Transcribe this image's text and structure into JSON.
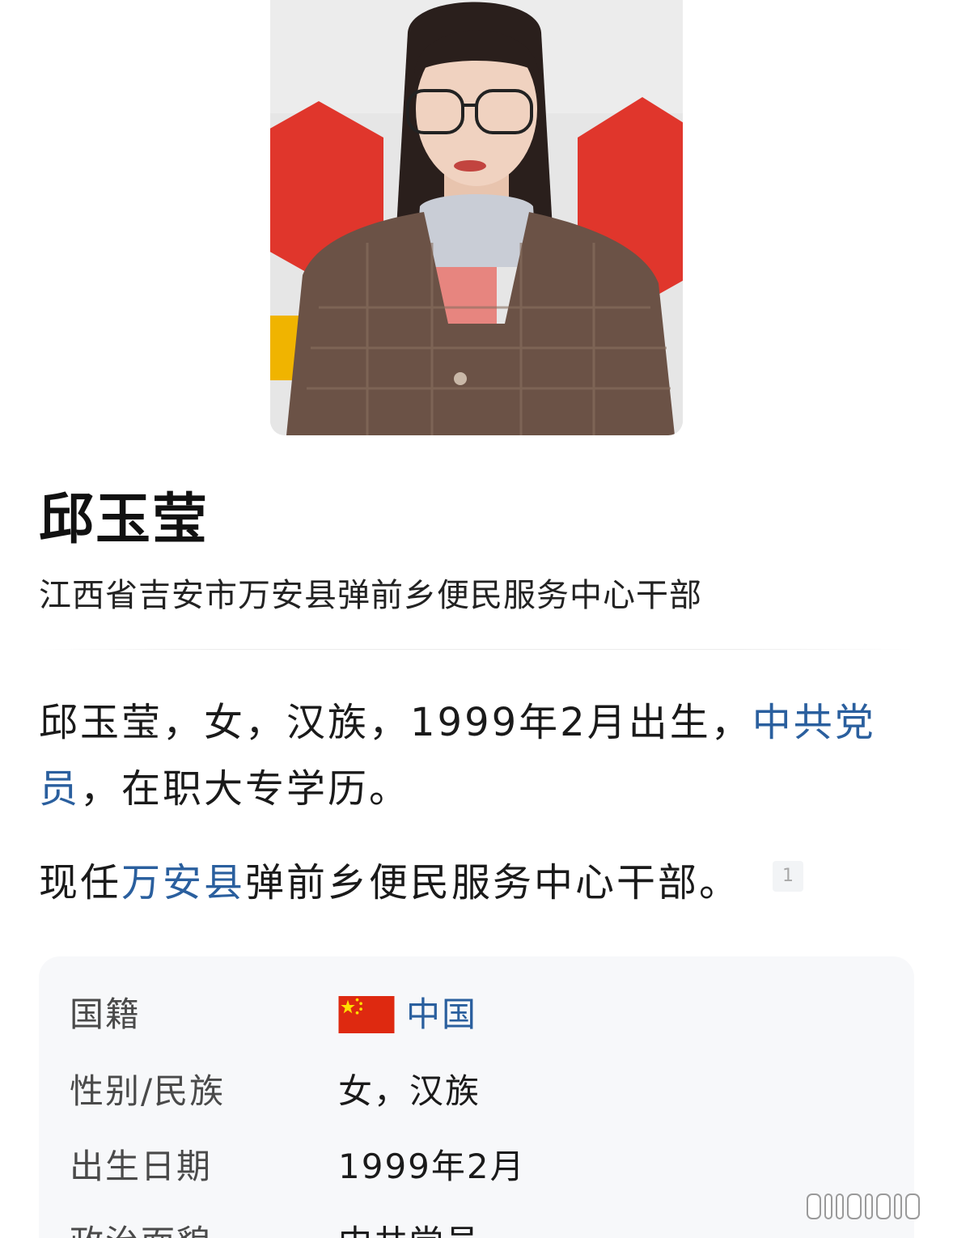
{
  "entry": {
    "title": "邱玉莹",
    "subtitle": "江西省吉安市万安县弹前乡便民服务中心干部"
  },
  "summary": {
    "p1_a": "邱玉莹，女，汉族，1999年2月出生，",
    "p1_link": "中共党员",
    "p1_b": "，在职大专学历。",
    "p2_a": "现任",
    "p2_link": "万安县",
    "p2_b": "弹前乡便民服务中心干部。",
    "p2_ref": "1"
  },
  "info": [
    {
      "label": "国籍",
      "value": "中国",
      "icon": "china-flag-icon",
      "link": true
    },
    {
      "label": "性别/民族",
      "value": "女，汉族"
    },
    {
      "label": "出生日期",
      "value": "1999年2月"
    },
    {
      "label": "政治面貌",
      "value": "中共党员"
    }
  ],
  "colors": {
    "link": "#2a5f9e",
    "card_bg": "#f7f8fa",
    "flag_red": "#de2910",
    "flag_star": "#ffde00"
  }
}
